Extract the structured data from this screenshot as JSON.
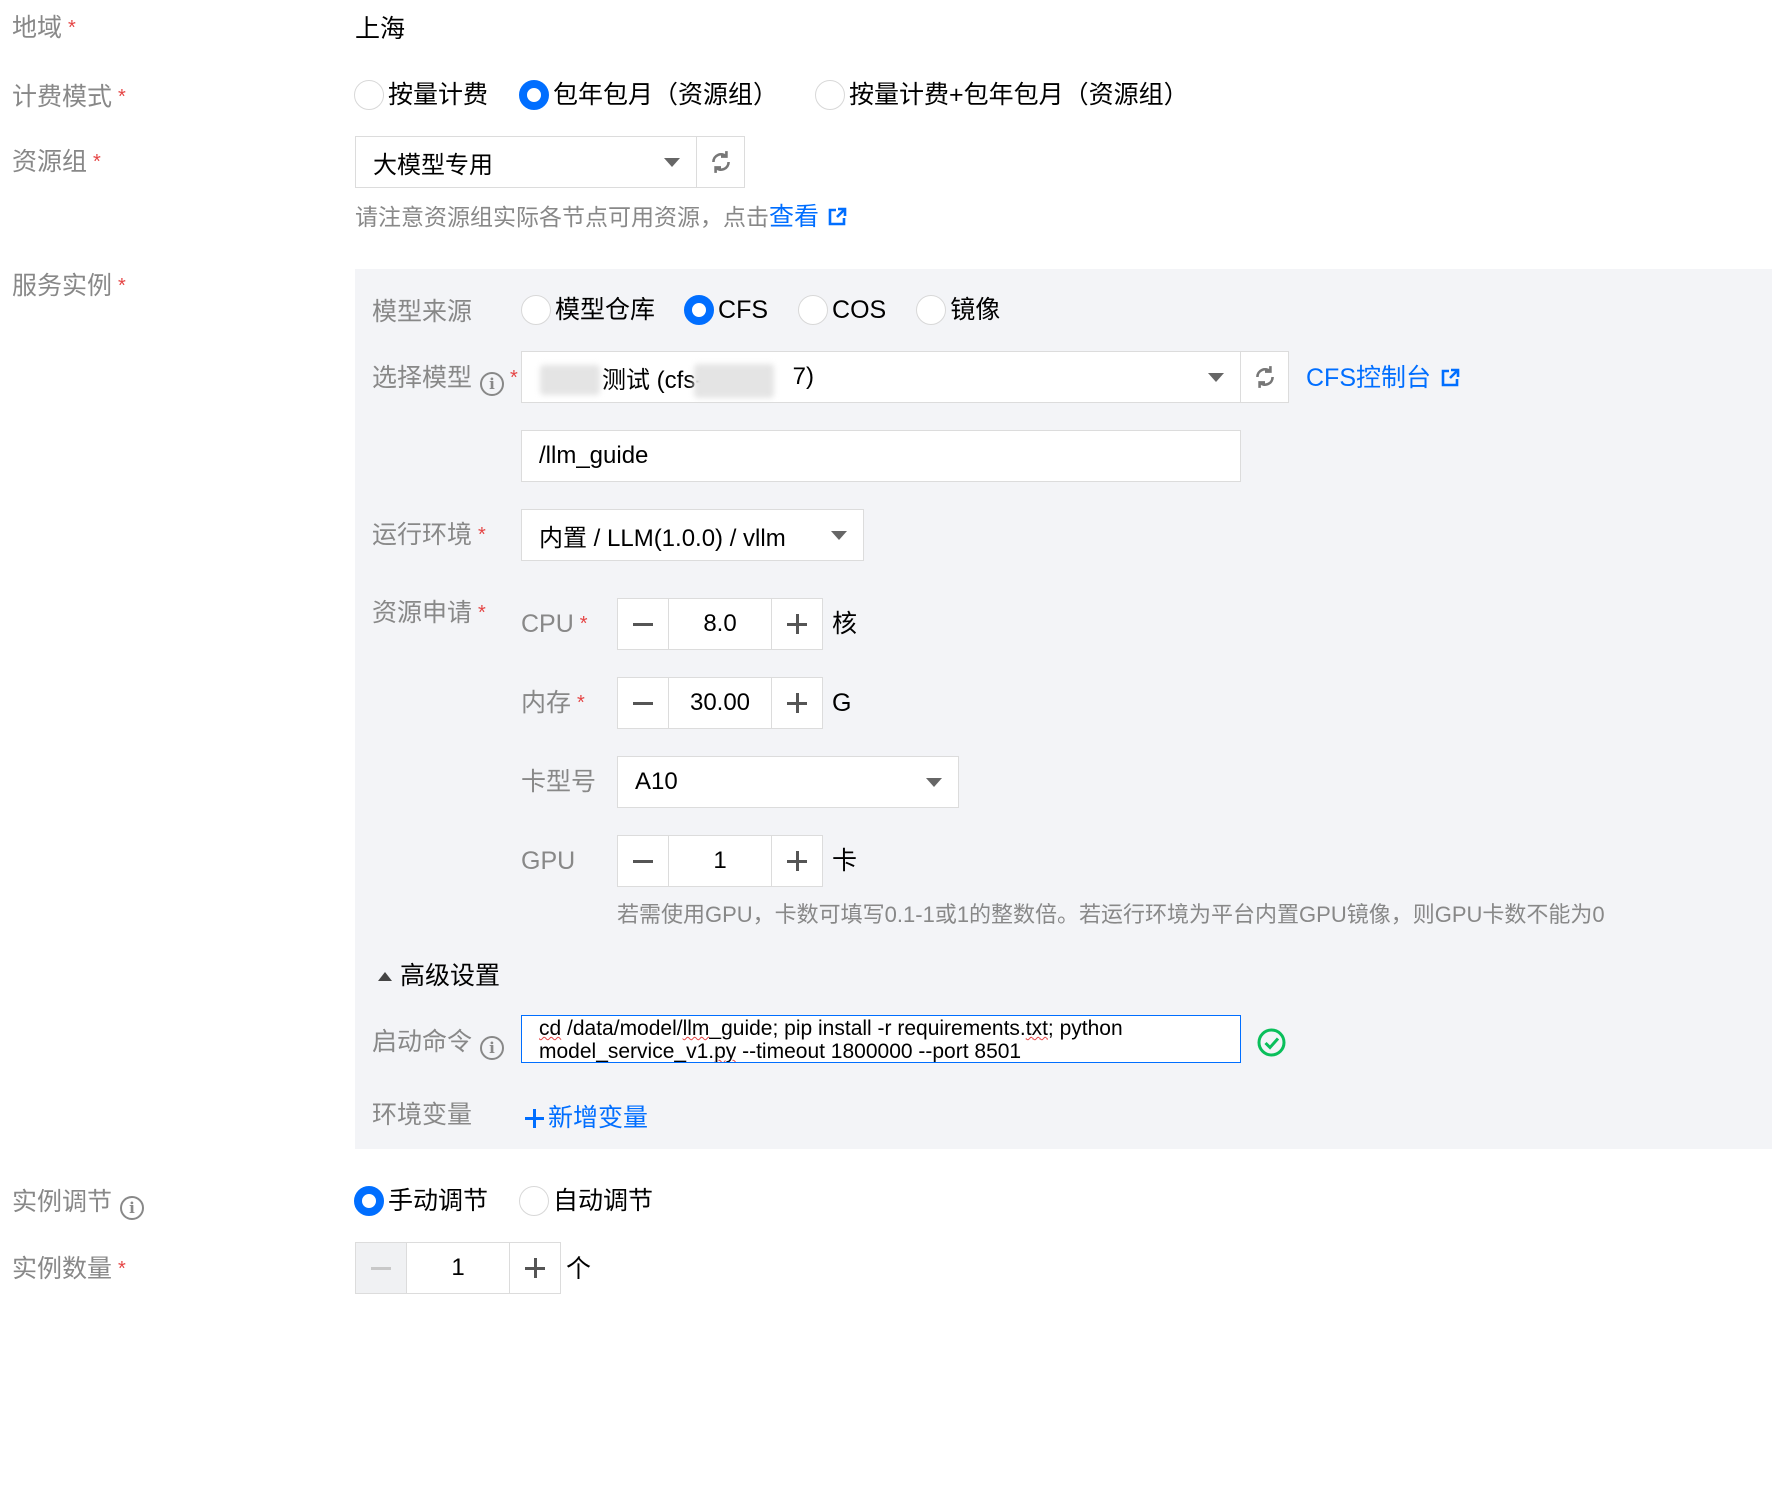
{
  "form": {
    "region": {
      "label": "地域",
      "value": "上海"
    },
    "billing": {
      "label": "计费模式",
      "options": [
        {
          "label": "按量计费",
          "selected": false
        },
        {
          "label": "包年包月（资源组）",
          "selected": true
        },
        {
          "label": "按量计费+包年包月（资源组）",
          "selected": false
        }
      ]
    },
    "resource_group": {
      "label": "资源组",
      "value": "大模型专用",
      "hint": "请注意资源组实际各节点可用资源，点击",
      "hint_link": "查看"
    },
    "service_instance": {
      "label": "服务实例",
      "model_source": {
        "label": "模型来源",
        "options": [
          {
            "label": "模型仓库",
            "selected": false
          },
          {
            "label": "CFS",
            "selected": true
          },
          {
            "label": "COS",
            "selected": false
          },
          {
            "label": "镜像",
            "selected": false
          }
        ]
      },
      "select_model": {
        "label": "选择模型",
        "value_visible": "测试 (cfs-4",
        "value_tail": "7)",
        "cfs_console_link": "CFS控制台",
        "path_value": "/llm_guide"
      },
      "runtime": {
        "label": "运行环境",
        "value": "内置 / LLM(1.0.0) / vllm"
      },
      "resource_request": {
        "label": "资源申请",
        "cpu": {
          "label": "CPU",
          "value": "8.0",
          "unit": "核"
        },
        "memory": {
          "label": "内存",
          "value": "30.00",
          "unit": "G"
        },
        "card_type": {
          "label": "卡型号",
          "value": "A10"
        },
        "gpu": {
          "label": "GPU",
          "value": "1",
          "unit": "卡"
        },
        "gpu_hint": "若需使用GPU，卡数可填写0.1-1或1的整数倍。若运行环境为平台内置GPU镜像，则GPU卡数不能为0"
      },
      "advanced": {
        "toggle_label": "高级设置",
        "start_command": {
          "label": "启动命令",
          "line1_a": "cd",
          "line1_b": " /data/model/",
          "line1_c": "llm",
          "line1_d": "_guide; pip install -r requirements.",
          "line1_e": "txt",
          "line1_f": "; python",
          "line2_a": "model_service_v1.",
          "line2_b": "py",
          "line2_c": " --timeout 1800000 --port 8501"
        },
        "env_vars": {
          "label": "环境变量",
          "add_link": "新增变量"
        }
      }
    },
    "instance_scaling": {
      "label": "实例调节",
      "options": [
        {
          "label": "手动调节",
          "selected": true
        },
        {
          "label": "自动调节",
          "selected": false
        }
      ]
    },
    "instance_count": {
      "label": "实例数量",
      "value": "1",
      "unit": "个"
    }
  },
  "colors": {
    "accent": "#006eff",
    "required": "#e54545",
    "success": "#0abf5b",
    "panel_bg": "#f3f4f7"
  }
}
